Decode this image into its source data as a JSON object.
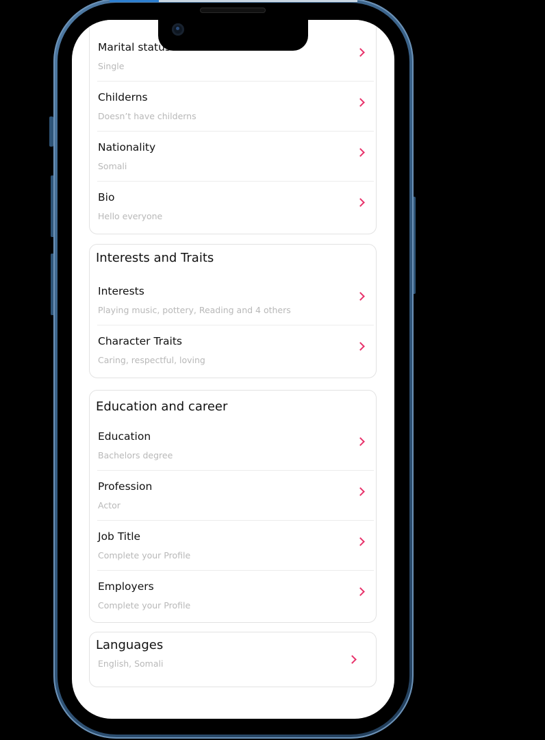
{
  "basic_section": {
    "items": [
      {
        "label": "Marital status",
        "value": "Single"
      },
      {
        "label": "Childerns",
        "value": "Doesn’t have childerns"
      },
      {
        "label": "Nationality",
        "value": "Somali"
      },
      {
        "label": "Bio",
        "value": "Hello everyone"
      }
    ]
  },
  "interests_section": {
    "title": "Interests  and Traits",
    "items": [
      {
        "label": "Interests",
        "value": "Playing music, pottery, Reading and 4 others"
      },
      {
        "label": "Character Traits",
        "value": "Caring,  respectful,  loving"
      }
    ]
  },
  "education_section": {
    "title": "Education and career",
    "items": [
      {
        "label": "Education",
        "value": "Bachelors degree"
      },
      {
        "label": "Profession",
        "value": "Actor"
      },
      {
        "label": "Job Title",
        "value": "Complete your Profile"
      },
      {
        "label": "Employers",
        "value": "Complete your Profile"
      }
    ]
  },
  "languages_section": {
    "title": "Languages",
    "value": "English, Somali"
  },
  "colors": {
    "accent": "#e8336b",
    "frame": "#355c82",
    "text_primary": "#111111",
    "text_secondary": "#b8b8b8"
  },
  "icons": {
    "row_chevron": "chevron-right-icon"
  }
}
